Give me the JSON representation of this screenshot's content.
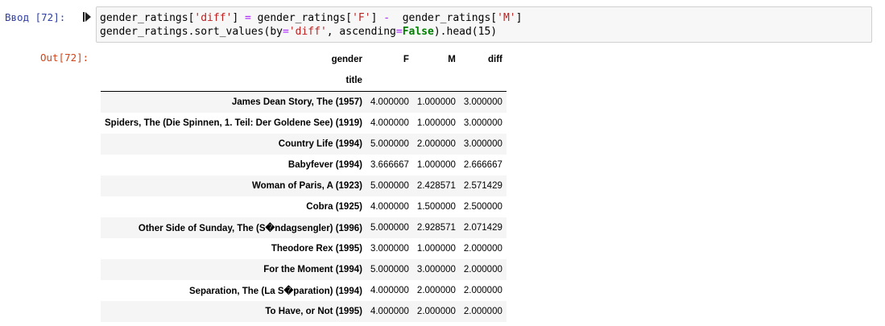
{
  "input_prompt": "Ввод [72]:",
  "output_prompt": "Out[72]:",
  "code": {
    "line1": [
      {
        "t": "gender_ratings[",
        "c": ""
      },
      {
        "t": "'diff'",
        "c": "str"
      },
      {
        "t": "] ",
        "c": ""
      },
      {
        "t": "=",
        "c": "op"
      },
      {
        "t": " gender_ratings[",
        "c": ""
      },
      {
        "t": "'F'",
        "c": "str"
      },
      {
        "t": "] ",
        "c": ""
      },
      {
        "t": "-",
        "c": "op"
      },
      {
        "t": "  gender_ratings[",
        "c": ""
      },
      {
        "t": "'M'",
        "c": "str"
      },
      {
        "t": "]",
        "c": ""
      }
    ],
    "line2": [
      {
        "t": "gender_ratings.sort_values(by",
        "c": ""
      },
      {
        "t": "=",
        "c": "op"
      },
      {
        "t": "'diff'",
        "c": "str"
      },
      {
        "t": ", ascending",
        "c": ""
      },
      {
        "t": "=",
        "c": "op"
      },
      {
        "t": "False",
        "c": "kw"
      },
      {
        "t": ").head(15)",
        "c": ""
      }
    ]
  },
  "table": {
    "columns_label": "gender",
    "columns": [
      "F",
      "M",
      "diff"
    ],
    "index_label": "title",
    "rows": [
      {
        "title": "James Dean Story, The (1957)",
        "F": "4.000000",
        "M": "1.000000",
        "diff": "3.000000"
      },
      {
        "title": "Spiders, The (Die Spinnen, 1. Teil: Der Goldene See) (1919)",
        "F": "4.000000",
        "M": "1.000000",
        "diff": "3.000000"
      },
      {
        "title": "Country Life (1994)",
        "F": "5.000000",
        "M": "2.000000",
        "diff": "3.000000"
      },
      {
        "title": "Babyfever (1994)",
        "F": "3.666667",
        "M": "1.000000",
        "diff": "2.666667"
      },
      {
        "title": "Woman of Paris, A (1923)",
        "F": "5.000000",
        "M": "2.428571",
        "diff": "2.571429"
      },
      {
        "title": "Cobra (1925)",
        "F": "4.000000",
        "M": "1.500000",
        "diff": "2.500000"
      },
      {
        "title": "Other Side of Sunday, The (S�ndagsengler) (1996)",
        "F": "5.000000",
        "M": "2.928571",
        "diff": "2.071429"
      },
      {
        "title": "Theodore Rex (1995)",
        "F": "3.000000",
        "M": "1.000000",
        "diff": "2.000000"
      },
      {
        "title": "For the Moment (1994)",
        "F": "5.000000",
        "M": "3.000000",
        "diff": "2.000000"
      },
      {
        "title": "Separation, The (La S�paration) (1994)",
        "F": "4.000000",
        "M": "2.000000",
        "diff": "2.000000"
      },
      {
        "title": "To Have, or Not (1995)",
        "F": "4.000000",
        "M": "2.000000",
        "diff": "2.000000"
      }
    ]
  }
}
